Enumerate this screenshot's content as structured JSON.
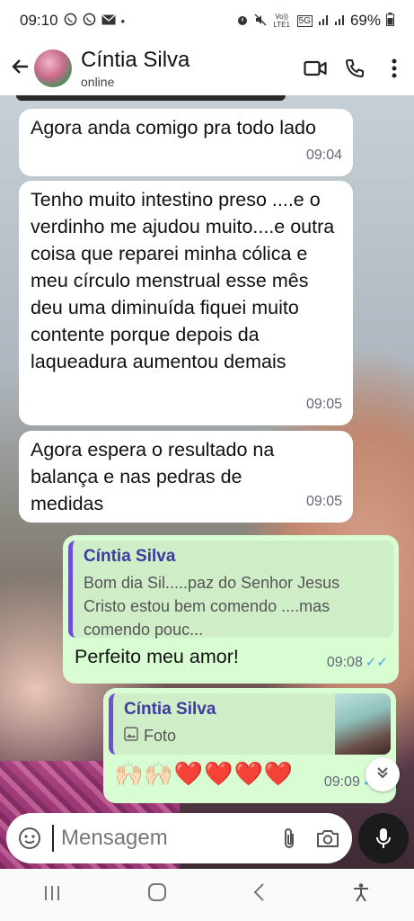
{
  "status_bar": {
    "time": "09:10",
    "left_icons": [
      "whatsapp-icon",
      "whatsapp-icon",
      "mail-icon",
      "dot"
    ],
    "right_icons": [
      "alarm-icon",
      "mute-icon",
      "volte-icon",
      "5g-icon",
      "signal-icon",
      "signal-icon"
    ],
    "volte_label": "Vo)) LTE1",
    "net_label": "5G",
    "battery": "69%"
  },
  "header": {
    "contact_name": "Cíntia Silva",
    "contact_status": "online"
  },
  "messages": [
    {
      "direction": "in",
      "text": "Agora anda comigo pra todo lado",
      "time": "09:04"
    },
    {
      "direction": "in",
      "text": "Tenho muito intestino preso ....e o verdinho me ajudou muito....e outra coisa que reparei minha cólica e meu círculo menstrual esse mês deu uma diminuída fiquei muito contente porque depois da laqueadura aumentou demais",
      "time": "09:05"
    },
    {
      "direction": "in",
      "text": "Agora espera o resultado na balança e nas pedras de medidas",
      "time": "09:05"
    },
    {
      "direction": "out",
      "quote_author": "Cíntia Silva",
      "quote_text": "Bom dia Sil.....paz do Senhor Jesus Cristo estou bem comendo ....mas comendo pouc...",
      "text": "Perfeito meu amor!",
      "time": "09:08"
    },
    {
      "direction": "out",
      "quote_author": "Cíntia Silva",
      "quote_text": "Foto",
      "text": "🙌🏻🙌🏻❤️❤️❤️❤️",
      "time": "09:09"
    }
  ],
  "input": {
    "placeholder": "Mensagem"
  },
  "colors": {
    "incoming_bubble": "#ffffff",
    "outgoing_bubble": "#d9fdd3",
    "quote_accent": "#6f4fd1",
    "read_ticks": "#4aa3e0"
  }
}
